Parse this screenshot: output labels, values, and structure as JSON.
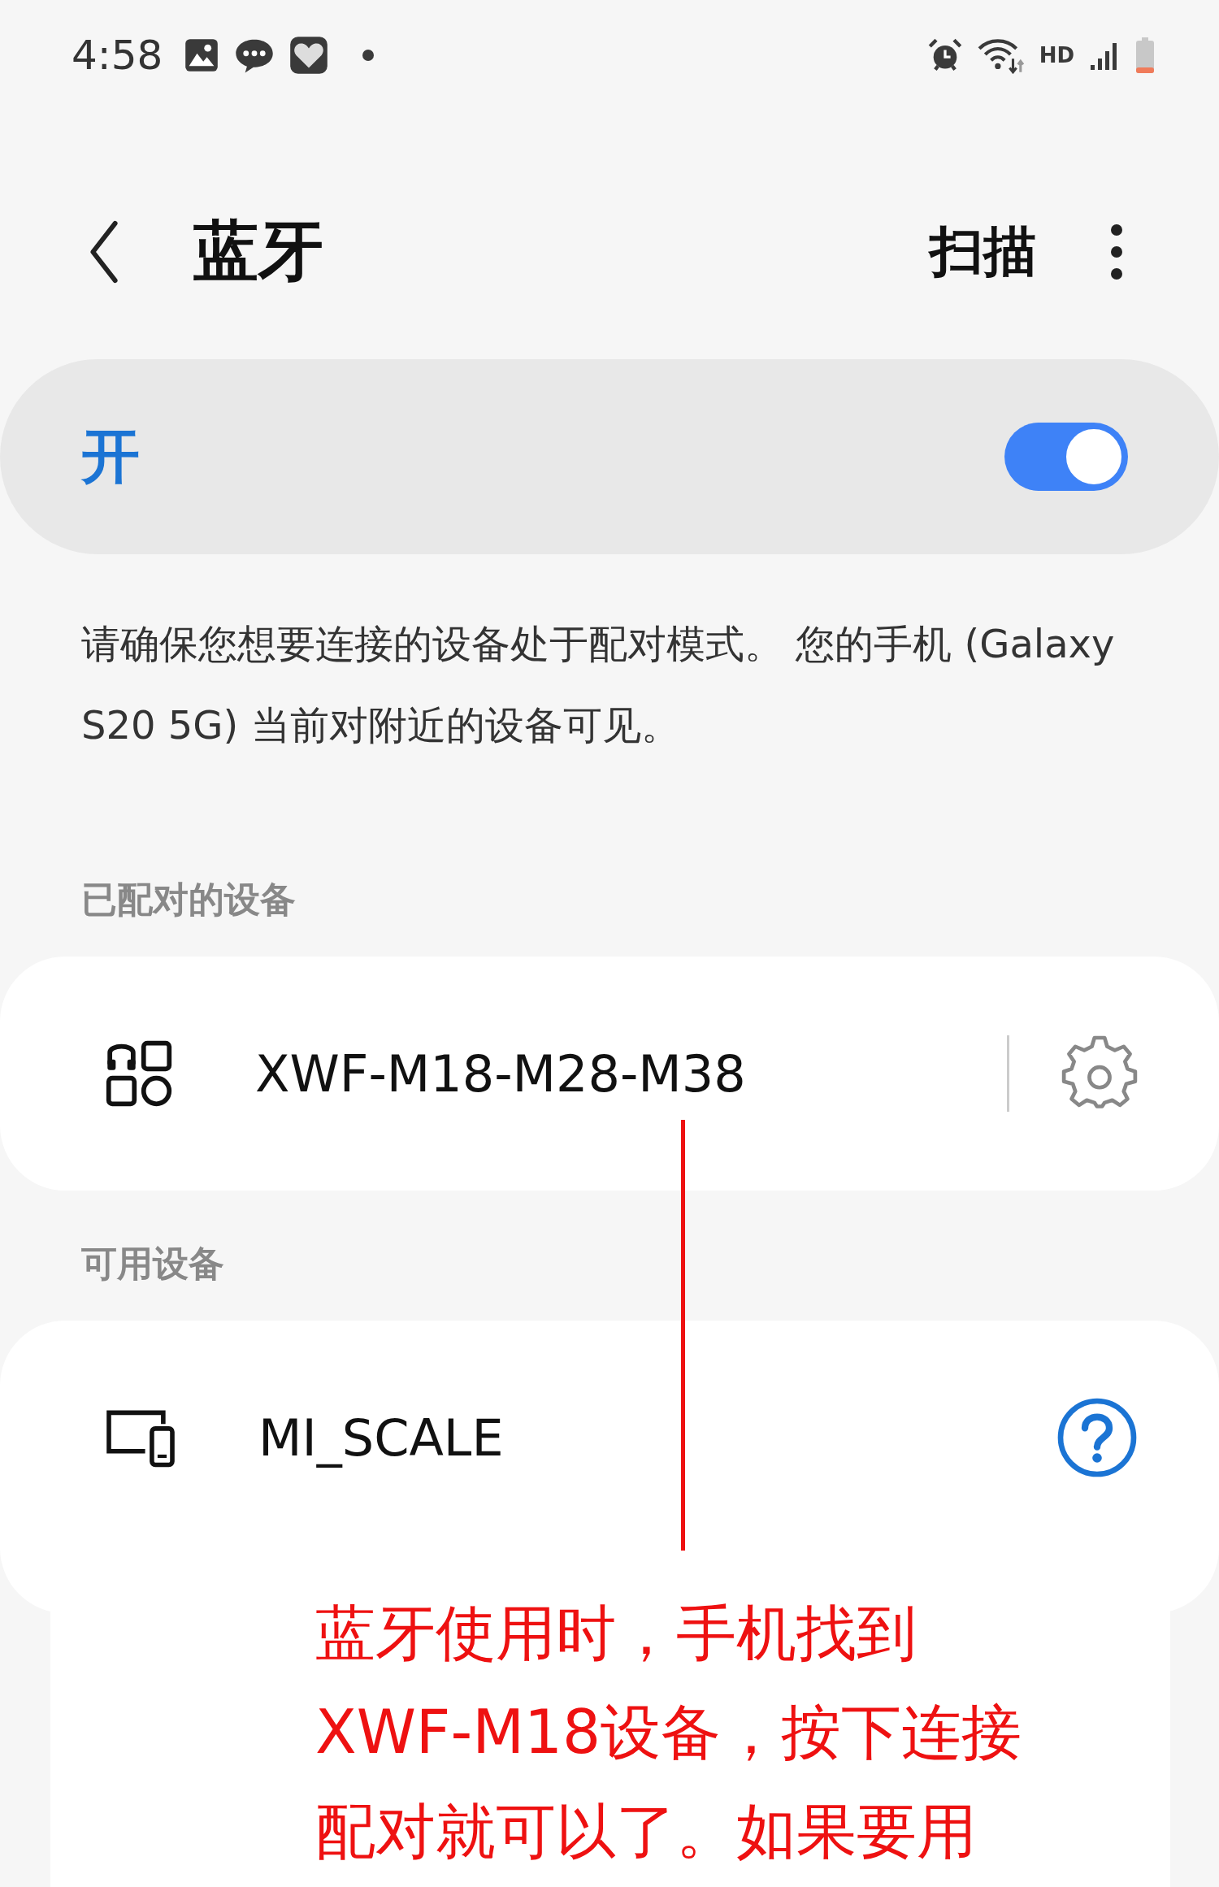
{
  "status_bar": {
    "time": "4:58",
    "network_label": "HD"
  },
  "header": {
    "title": "蓝牙",
    "action": "扫描"
  },
  "bluetooth": {
    "label": "开",
    "on": true
  },
  "description": "请确保您想要连接的设备处于配对模式。 您的手机 (Galaxy S20 5G) 当前对附近的设备可见。",
  "sections": [
    {
      "title": "已配对的设备",
      "devices": [
        {
          "name": "XWF-M18-M28-M38",
          "kind": "paired"
        }
      ]
    },
    {
      "title": "可用设备",
      "devices": [
        {
          "name": "MI_SCALE",
          "kind": "available"
        }
      ]
    }
  ],
  "annotation": {
    "lines": [
      "蓝牙使用时，手机找到",
      "XWF-M18设备，按下连接",
      "配对就可以了。如果要用"
    ]
  }
}
